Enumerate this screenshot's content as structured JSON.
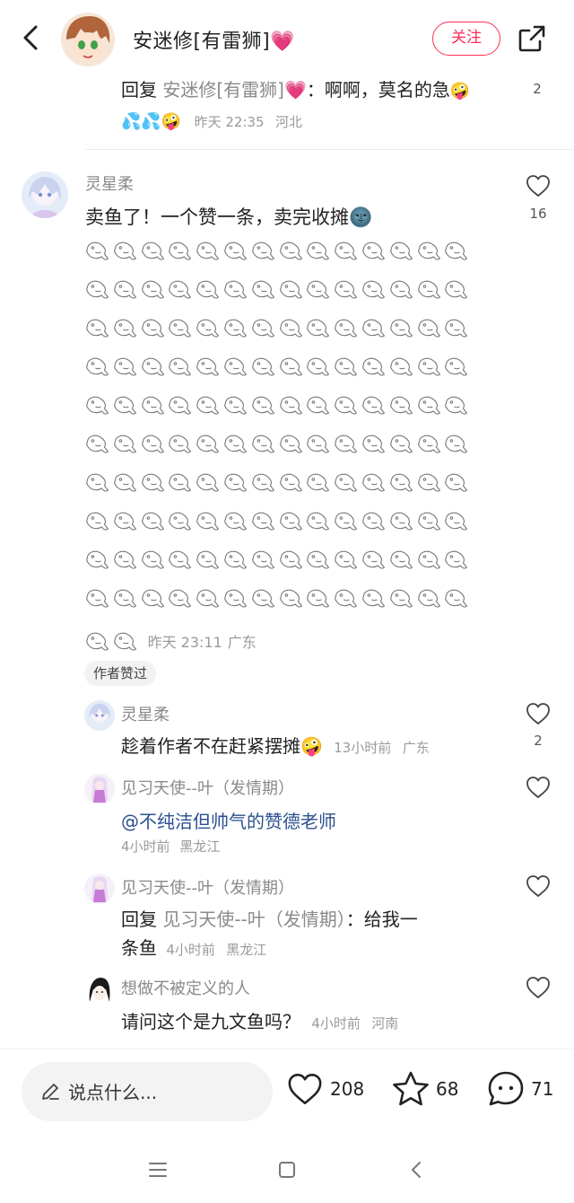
{
  "header": {
    "author_name": "安迷修[有雷狮]💗",
    "follow_label": "关注"
  },
  "reply_top": {
    "prefix": "回复 ",
    "quoted_user": "安迷修[有雷狮]💗",
    "colon": "：",
    "text": "啊啊，莫名的急",
    "emojis": "🤪💦💦🤪",
    "time": "昨天 22:35",
    "location": "河北",
    "likes": "2"
  },
  "main_comment": {
    "user": "灵星柔",
    "text": "卖鱼了！一个赞一条，卖完收摊🌚",
    "time": "昨天 23:11",
    "location": "广东",
    "likes": "16",
    "author_liked_badge": "作者赞过"
  },
  "sub_comments": [
    {
      "user": "灵星柔",
      "text": "趁着作者不在赶紧摆摊🤪",
      "time": "13小时前",
      "location": "广东",
      "likes": "2"
    },
    {
      "user": "见习天使--叶（发情期）",
      "text": "@不纯洁但帅气的赞德老师",
      "time": "4小时前",
      "location": "黑龙江",
      "likes": ""
    },
    {
      "user": "见习天使--叶（发情期）",
      "prefix": "回复 ",
      "quoted_user": "见习天使--叶（发情期）",
      "colon": "：",
      "text_line1": "给我一",
      "text_line2": "条鱼",
      "time": "4小时前",
      "location": "黑龙江",
      "likes": ""
    },
    {
      "user": "想做不被定义的人",
      "text": "请问这个是九文鱼吗？",
      "time": "4小时前",
      "location": "河南",
      "likes": ""
    }
  ],
  "bottom_bar": {
    "input_placeholder": "说点什么...",
    "likes": "208",
    "favorites": "68",
    "comments": "71"
  },
  "icons": {
    "back": "back-arrow-icon",
    "share": "share-icon",
    "like": "heart-outline-icon",
    "favorite": "star-outline-icon",
    "comment": "comment-bubble-icon",
    "fish": "fish-outline-icon",
    "nav_menu": "menu-icon",
    "nav_home": "home-square-icon",
    "nav_back": "nav-back-icon"
  },
  "colors": {
    "accent": "#ff2d55",
    "mention": "#2b4f8f",
    "secondary_text": "#8a8a8a"
  }
}
